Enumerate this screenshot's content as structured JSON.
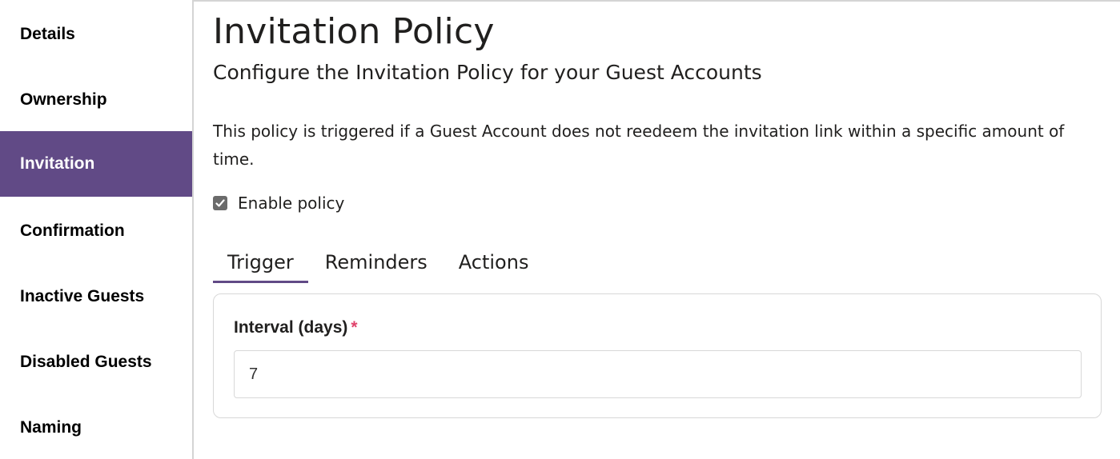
{
  "sidebar": {
    "items": [
      {
        "label": "Details",
        "active": false
      },
      {
        "label": "Ownership",
        "active": false
      },
      {
        "label": "Invitation",
        "active": true
      },
      {
        "label": "Confirmation",
        "active": false
      },
      {
        "label": "Inactive Guests",
        "active": false
      },
      {
        "label": "Disabled Guests",
        "active": false
      },
      {
        "label": "Naming",
        "active": false
      }
    ]
  },
  "colors": {
    "accent": "#614a86",
    "required": "#e0426b",
    "border": "#d8d8d8"
  },
  "main": {
    "title": "Invitation Policy",
    "subtitle": "Configure the Invitation Policy for your Guest Accounts",
    "description": "This policy is triggered if a Guest Account does not reedeem the invitation link within a specific amount of time.",
    "enable_policy": {
      "label": "Enable policy",
      "checked": true,
      "icon": "checkmark-icon"
    },
    "tabs": [
      {
        "label": "Trigger",
        "active": true
      },
      {
        "label": "Reminders",
        "active": false
      },
      {
        "label": "Actions",
        "active": false
      }
    ],
    "trigger": {
      "interval_label": "Interval (days)",
      "required_marker": "*",
      "interval_value": "7"
    }
  }
}
